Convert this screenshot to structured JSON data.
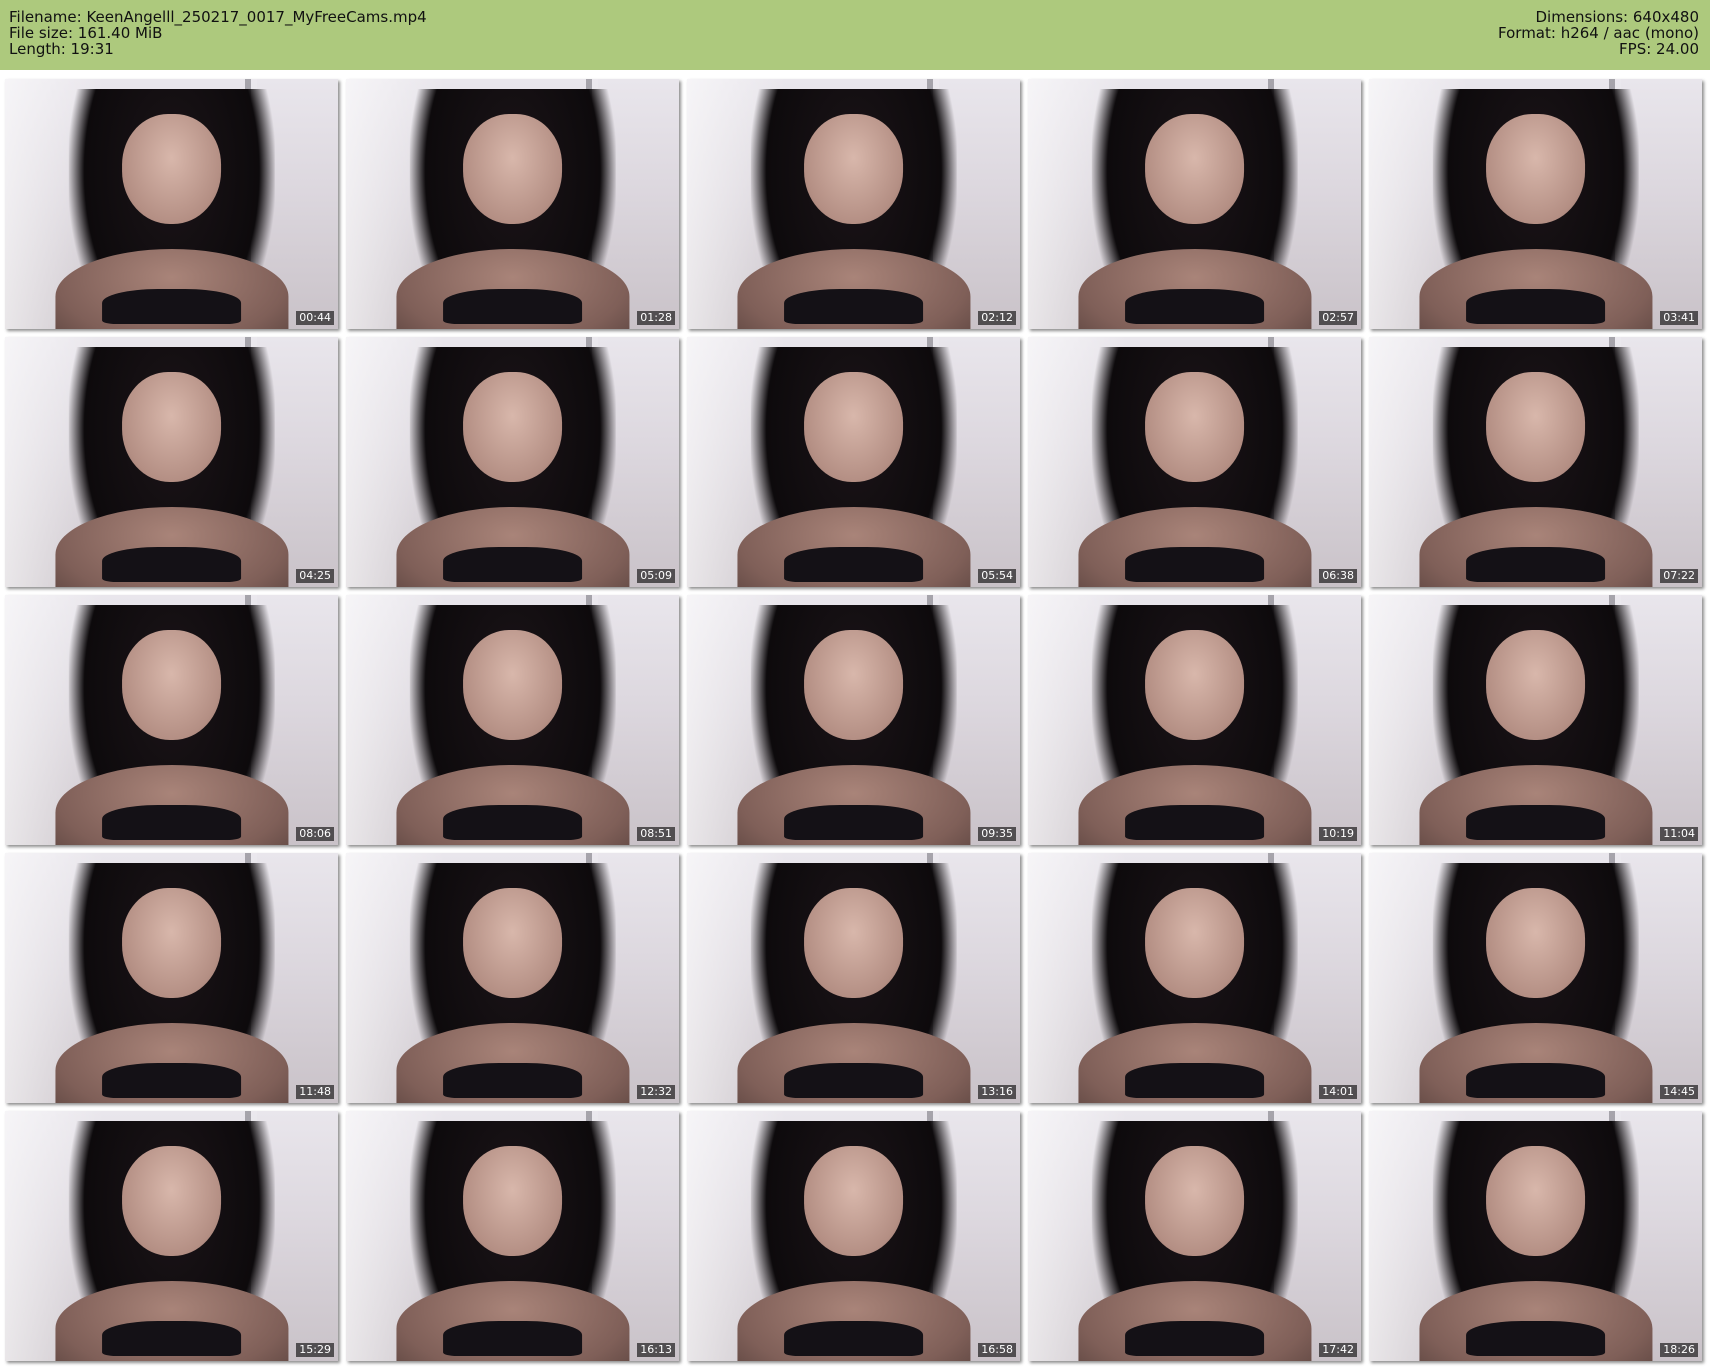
{
  "header": {
    "filename": "Filename: KeenAngelll_250217_0017_MyFreeCams.mp4",
    "filesize": "File size: 161.40 MiB",
    "length": "Length: 19:31",
    "dimensions": "Dimensions: 640x480",
    "format": "Format: h264 / aac (mono)",
    "fps": "FPS: 24.00",
    "background_color": "#adc97d"
  },
  "thumbnails": [
    {
      "timestamp": "00:44"
    },
    {
      "timestamp": "01:28"
    },
    {
      "timestamp": "02:12"
    },
    {
      "timestamp": "02:57"
    },
    {
      "timestamp": "03:41"
    },
    {
      "timestamp": "04:25"
    },
    {
      "timestamp": "05:09"
    },
    {
      "timestamp": "05:54"
    },
    {
      "timestamp": "06:38"
    },
    {
      "timestamp": "07:22"
    },
    {
      "timestamp": "08:06"
    },
    {
      "timestamp": "08:51"
    },
    {
      "timestamp": "09:35"
    },
    {
      "timestamp": "10:19"
    },
    {
      "timestamp": "11:04"
    },
    {
      "timestamp": "11:48"
    },
    {
      "timestamp": "12:32"
    },
    {
      "timestamp": "13:16"
    },
    {
      "timestamp": "14:01"
    },
    {
      "timestamp": "14:45"
    },
    {
      "timestamp": "15:29"
    },
    {
      "timestamp": "16:13"
    },
    {
      "timestamp": "16:58"
    },
    {
      "timestamp": "17:42"
    },
    {
      "timestamp": "18:26"
    }
  ]
}
